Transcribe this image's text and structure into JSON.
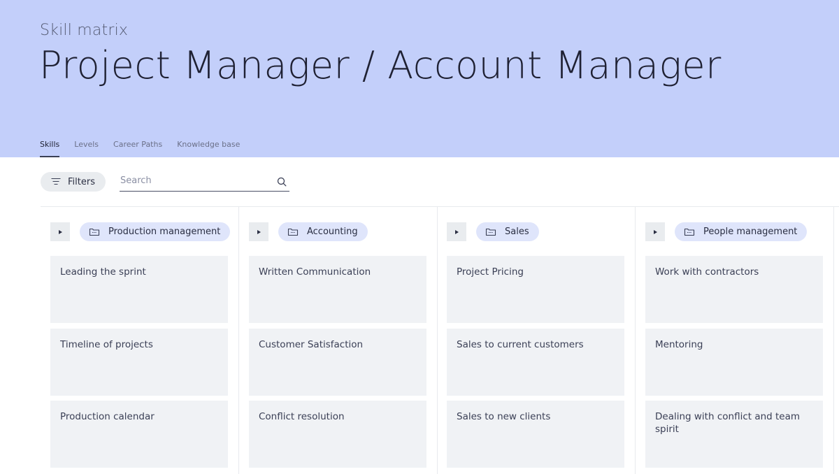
{
  "header": {
    "subtitle": "Skill matrix",
    "title": "Project Manager / Account Manager"
  },
  "tabs": [
    {
      "label": "Skills",
      "active": true
    },
    {
      "label": "Levels",
      "active": false
    },
    {
      "label": "Career Paths",
      "active": false
    },
    {
      "label": "Knowledge base",
      "active": false
    }
  ],
  "toolbar": {
    "filters_label": "Filters",
    "search_placeholder": "Search",
    "search_value": ""
  },
  "columns": [
    {
      "category": "Production management",
      "skills": [
        "Leading the sprint",
        "Timeline of projects",
        "Production calendar"
      ]
    },
    {
      "category": "Accounting",
      "skills": [
        "Written Communication",
        "Customer Satisfaction",
        "Conflict resolution"
      ]
    },
    {
      "category": "Sales",
      "skills": [
        "Project Pricing",
        "Sales to current customers",
        "Sales to new clients"
      ]
    },
    {
      "category": "People management",
      "skills": [
        "Work with contractors",
        "Mentoring",
        "Dealing with conflict and team spirit"
      ]
    }
  ],
  "colors": {
    "header_bg": "#c3cffa",
    "chip_bg": "#dfe5fb",
    "card_bg": "#f0f2f5"
  }
}
